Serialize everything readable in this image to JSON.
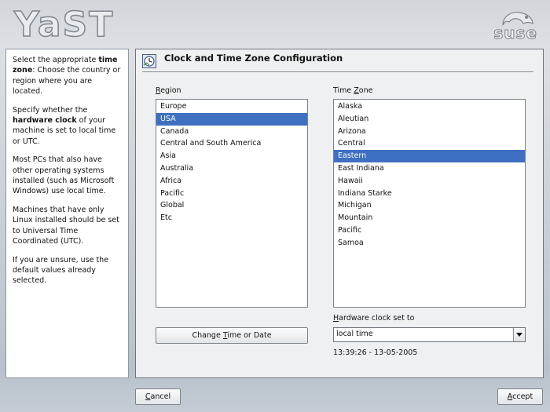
{
  "header": {
    "app_logo": "YaST",
    "brand_logo": "suse"
  },
  "help": {
    "p1": [
      "Select the appropriate ",
      "time zone",
      ": Choose the country or region where you are located."
    ],
    "p2": [
      "Specify whether the ",
      "hardware clock",
      " of your machine is set to local time or UTC."
    ],
    "p3": "Most PCs that also have other operating systems installed (such as Microsoft Windows) use local time.",
    "p4": "Machines that have only Linux installed should be set to Universal Time Coordinated (UTC).",
    "p5": "If you are unsure, use the default values already selected."
  },
  "dialog": {
    "title": "Clock and Time Zone Configuration",
    "title_icon": "clock-globe-icon"
  },
  "region": {
    "label_u": "R",
    "label_rest": "egion",
    "items": [
      "Europe",
      "USA",
      "Canada",
      "Central and South America",
      "Asia",
      "Australia",
      "Africa",
      "Pacific",
      "Global",
      "Etc"
    ],
    "selected": "USA"
  },
  "timezone": {
    "label_pre": "Time ",
    "label_u": "Z",
    "label_rest": "one",
    "items": [
      "Alaska",
      "Aleutian",
      "Arizona",
      "Central",
      "Eastern",
      "East Indiana",
      "Hawaii",
      "Indiana Starke",
      "Michigan",
      "Mountain",
      "Pacific",
      "Samoa"
    ],
    "selected": "Eastern"
  },
  "change_button": {
    "pre": "Change ",
    "u": "T",
    "rest": "ime or Date"
  },
  "hwclock": {
    "label_u": "H",
    "label_rest": "ardware clock set to",
    "value": "local time",
    "datetime": "13:39:26 - 13-05-2005"
  },
  "footer": {
    "cancel_u": "C",
    "cancel_rest": "ancel",
    "accept_u": "A",
    "accept_rest": "ccept"
  },
  "colors": {
    "selection": "#3f6fc1",
    "panel": "#eff0f1"
  }
}
